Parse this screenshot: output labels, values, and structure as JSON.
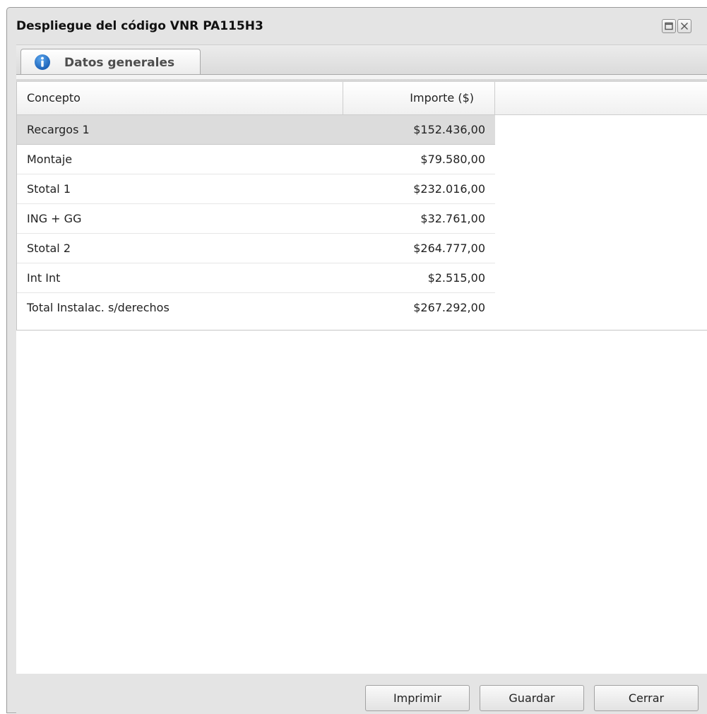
{
  "window": {
    "title": "Despliegue del código VNR PA115H3",
    "maximize_icon": "maximize-icon",
    "close_icon": "close-icon"
  },
  "tabs": [
    {
      "label": "Datos generales",
      "icon": "info-icon",
      "active": true
    }
  ],
  "grid": {
    "columns": [
      "Concepto",
      "Importe ($)"
    ],
    "rows": [
      {
        "concepto": "Recargos 1",
        "importe": "$152.436,00",
        "selected": true
      },
      {
        "concepto": "Montaje",
        "importe": "$79.580,00"
      },
      {
        "concepto": "Stotal 1",
        "importe": "$232.016,00"
      },
      {
        "concepto": "ING + GG",
        "importe": "$32.761,00"
      },
      {
        "concepto": "Stotal 2",
        "importe": "$264.777,00"
      },
      {
        "concepto": "Int Int",
        "importe": "$2.515,00"
      },
      {
        "concepto": "Total Instalac. s/derechos",
        "importe": "$267.292,00"
      }
    ]
  },
  "footer": {
    "print_label": "Imprimir",
    "save_label": "Guardar",
    "close_label": "Cerrar"
  },
  "colors": {
    "selected_row": "#dcdcdc",
    "window_frame": "#e4e4e4",
    "tab_icon": "#1f6fc5"
  }
}
